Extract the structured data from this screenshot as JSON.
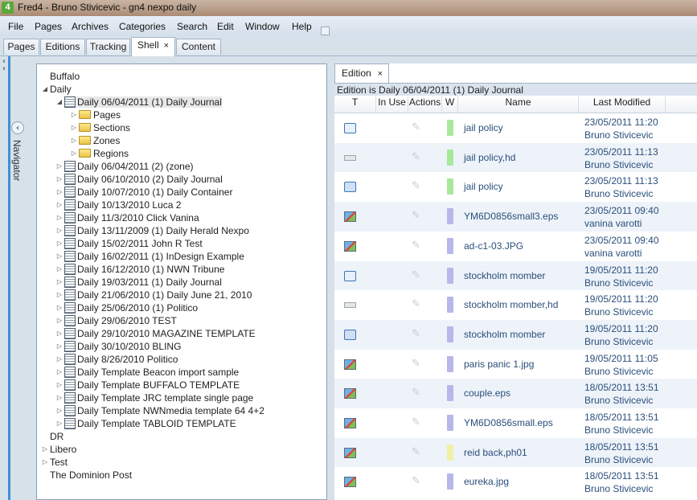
{
  "window": {
    "title": "Fred4 - Bruno Stivicevic - gn4 nexpo daily",
    "app_badge": "4"
  },
  "menu": [
    "File",
    "Pages",
    "Archives",
    "Categories",
    "Search",
    "Edit",
    "Window",
    "Help"
  ],
  "tabs": [
    {
      "label": "Pages"
    },
    {
      "label": "Editions"
    },
    {
      "label": "Tracking"
    },
    {
      "label": "Shell",
      "close": "×"
    },
    {
      "label": "Content"
    }
  ],
  "navigator": {
    "label": "Navigator"
  },
  "tree": [
    {
      "label": "Buffalo",
      "level": 0,
      "expander": "",
      "icon": "none"
    },
    {
      "label": "Daily",
      "level": 0,
      "expander": "◢",
      "icon": "none"
    },
    {
      "label": "Daily 06/04/2011 (1) Daily Journal",
      "level": 1,
      "expander": "◢",
      "icon": "doc",
      "selected": true
    },
    {
      "label": "Pages",
      "level": 2,
      "expander": "▷",
      "icon": "folder"
    },
    {
      "label": "Sections",
      "level": 2,
      "expander": "▷",
      "icon": "folder"
    },
    {
      "label": "Zones",
      "level": 2,
      "expander": "▷",
      "icon": "folder"
    },
    {
      "label": "Regions",
      "level": 2,
      "expander": "▷",
      "icon": "folder"
    },
    {
      "label": "Daily 06/04/2011 (2) (zone)",
      "level": 1,
      "expander": "▷",
      "icon": "doc"
    },
    {
      "label": "Daily 06/10/2010 (2) Daily Journal",
      "level": 1,
      "expander": "▷",
      "icon": "doc"
    },
    {
      "label": "Daily 10/07/2010 (1) Daily Container",
      "level": 1,
      "expander": "▷",
      "icon": "doc"
    },
    {
      "label": "Daily 10/13/2010 Luca 2",
      "level": 1,
      "expander": "▷",
      "icon": "doc"
    },
    {
      "label": "Daily 11/3/2010 Click Vanina",
      "level": 1,
      "expander": "▷",
      "icon": "doc"
    },
    {
      "label": "Daily 13/11/2009 (1) Daily Herald Nexpo",
      "level": 1,
      "expander": "▷",
      "icon": "doc"
    },
    {
      "label": "Daily 15/02/2011 John R Test",
      "level": 1,
      "expander": "▷",
      "icon": "doc"
    },
    {
      "label": "Daily 16/02/2011 (1) InDesign Example",
      "level": 1,
      "expander": "▷",
      "icon": "doc"
    },
    {
      "label": "Daily 16/12/2010 (1) NWN Tribune",
      "level": 1,
      "expander": "▷",
      "icon": "doc"
    },
    {
      "label": "Daily 19/03/2011 (1) Daily Journal",
      "level": 1,
      "expander": "▷",
      "icon": "doc"
    },
    {
      "label": "Daily 21/06/2010 (1) Daily June 21, 2010",
      "level": 1,
      "expander": "▷",
      "icon": "doc"
    },
    {
      "label": "Daily 25/06/2010 (1) Politico",
      "level": 1,
      "expander": "▷",
      "icon": "doc"
    },
    {
      "label": "Daily 29/06/2010 TEST",
      "level": 1,
      "expander": "▷",
      "icon": "doc"
    },
    {
      "label": "Daily 29/10/2010 MAGAZINE TEMPLATE",
      "level": 1,
      "expander": "▷",
      "icon": "doc"
    },
    {
      "label": "Daily 30/10/2010 BLING",
      "level": 1,
      "expander": "▷",
      "icon": "doc"
    },
    {
      "label": "Daily 8/26/2010 Politico",
      "level": 1,
      "expander": "▷",
      "icon": "doc"
    },
    {
      "label": "Daily Template Beacon import sample",
      "level": 1,
      "expander": "▷",
      "icon": "doc"
    },
    {
      "label": "Daily Template BUFFALO TEMPLATE",
      "level": 1,
      "expander": "▷",
      "icon": "doc"
    },
    {
      "label": "Daily Template JRC template single page",
      "level": 1,
      "expander": "▷",
      "icon": "doc"
    },
    {
      "label": "Daily Template NWNmedia template 64 4+2",
      "level": 1,
      "expander": "▷",
      "icon": "doc"
    },
    {
      "label": "Daily Template TABLOID TEMPLATE",
      "level": 1,
      "expander": "▷",
      "icon": "doc"
    },
    {
      "label": "DR",
      "level": 0,
      "expander": "",
      "icon": "none"
    },
    {
      "label": "Libero",
      "level": 0,
      "expander": "▷",
      "icon": "none"
    },
    {
      "label": "Test",
      "level": 0,
      "expander": "▷",
      "icon": "none"
    },
    {
      "label": "The Dominion Post",
      "level": 0,
      "expander": "",
      "icon": "none"
    }
  ],
  "edition": {
    "tab_label": "Edition",
    "tab_close": "×",
    "header": "Edition is Daily 06/04/2011 (1) Daily Journal",
    "columns": [
      "T",
      "In Use",
      "Actions",
      "W",
      "Name",
      "Last Modified"
    ],
    "rows": [
      {
        "type": "layout",
        "name": "jail policy",
        "date": "23/05/2011 11:20",
        "user": "Bruno Stivicevic",
        "w": "#a8e89a"
      },
      {
        "type": "text",
        "name": "jail policy,hd",
        "date": "23/05/2011 11:13",
        "user": "Bruno Stivicevic",
        "w": "#a8e89a"
      },
      {
        "type": "page",
        "name": "jail policy",
        "date": "23/05/2011 11:13",
        "user": "Bruno Stivicevic",
        "w": "#a8e89a"
      },
      {
        "type": "image",
        "name": "YM6D0856small3.eps",
        "date": "23/05/2011 09:40",
        "user": "vanina varotti",
        "w": "#b9b6ea"
      },
      {
        "type": "image",
        "name": "ad-c1-03.JPG",
        "date": "23/05/2011 09:40",
        "user": "vanina varotti",
        "w": "#b9b6ea"
      },
      {
        "type": "layout",
        "name": "stockholm momber",
        "date": "19/05/2011 11:20",
        "user": "Bruno Stivicevic",
        "w": "#b9b6ea"
      },
      {
        "type": "text",
        "name": "stockholm momber,hd",
        "date": "19/05/2011 11:20",
        "user": "Bruno Stivicevic",
        "w": "#b9b6ea"
      },
      {
        "type": "page",
        "name": "stockholm momber",
        "date": "19/05/2011 11:20",
        "user": "Bruno Stivicevic",
        "w": "#b9b6ea"
      },
      {
        "type": "image",
        "name": "paris panic 1.jpg",
        "date": "19/05/2011 11:05",
        "user": "Bruno Stivicevic",
        "w": "#b9b6ea"
      },
      {
        "type": "image",
        "name": "couple.eps",
        "date": "18/05/2011 13:51",
        "user": "Bruno Stivicevic",
        "w": "#b9b6ea"
      },
      {
        "type": "image",
        "name": "YM6D0856small.eps",
        "date": "18/05/2011 13:51",
        "user": "Bruno Stivicevic",
        "w": "#b9b6ea"
      },
      {
        "type": "image",
        "name": "reid back,ph01",
        "date": "18/05/2011 13:51",
        "user": "Bruno Stivicevic",
        "w": "#f1efa8"
      },
      {
        "type": "image",
        "name": "eureka.jpg",
        "date": "18/05/2011 13:51",
        "user": "Bruno Stivicevic",
        "w": "#b9b6ea"
      }
    ]
  }
}
